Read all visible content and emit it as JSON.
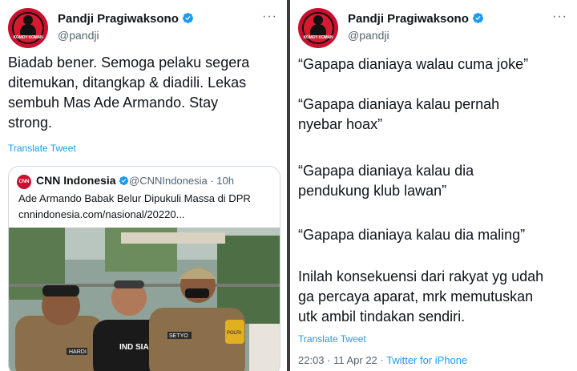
{
  "left_tweet": {
    "author_name": "Pandji Pragiwaksono",
    "author_handle": "@pandji",
    "avatar_text": "KOMOY KOMAN",
    "text_lines": [
      "Biadab bener. Semoga pelaku segera",
      "ditemukan, ditangkap & diadili. Lekas",
      "sembuh Mas Ade Armando. Stay",
      "strong."
    ],
    "translate_label": "Translate Tweet",
    "quote": {
      "logo_text": "CNN",
      "name": "CNN Indonesia",
      "handle_time": "@CNNIndonesia · 10h",
      "title": "Ade Armando Babak Belur Dipukuli Massa di DPR",
      "link": "cnnindonesia.com/nasional/20220...",
      "photo_texts": {
        "badge_left": "HARDI",
        "badge_right": "SETYO",
        "police": "POLRI",
        "shirt": "IND SIA UN"
      }
    }
  },
  "right_tweet": {
    "author_name": "Pandji Pragiwaksono",
    "author_handle": "@pandji",
    "avatar_text": "KOMOY KOMAN",
    "lines": [
      "“Gapapa dianiaya walau cuma joke”",
      "“Gapapa dianiaya kalau pernah",
      "nyebar hoax”",
      "“Gapapa dianiaya kalau dia",
      "pendukung klub lawan”",
      "“Gapapa dianiaya kalau dia maling”",
      "Inilah konsekuensi dari rakyat yg udah",
      "ga percaya aparat, mrk memutuskan",
      "utk ambil tindakan sendiri."
    ],
    "translate_label": "Translate Tweet",
    "timestamp": "22:03 · 11 Apr 22 · ",
    "source": "Twitter for iPhone"
  },
  "colors": {
    "link_blue": "#1d9bf0",
    "secondary_text": "#536471",
    "avatar_red": "#c8102e",
    "divider": "#3a3a3a"
  },
  "icons": [
    "verified-badge-icon",
    "more-options-icon"
  ]
}
